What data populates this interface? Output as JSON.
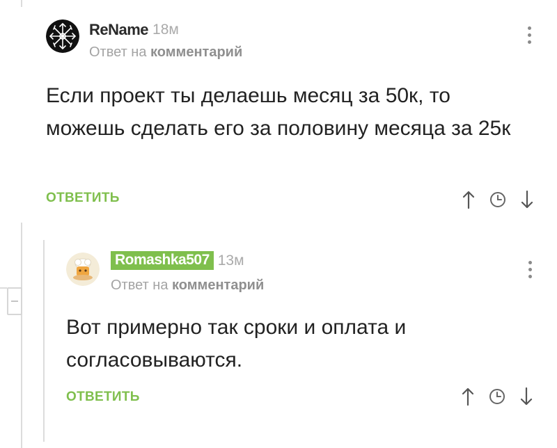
{
  "comments": [
    {
      "username": "ReName",
      "time": "18м",
      "reply_prefix": "Ответ на",
      "reply_target": "комментарий",
      "text": "Если проект ты делаешь месяц за 50к, то можешь сделать его за половину месяца за 25к",
      "reply_label": "ОТВЕТИТЬ"
    },
    {
      "username": "Romashka507",
      "time": "13м",
      "reply_prefix": "Ответ на",
      "reply_target": "комментарий",
      "text": "Вот примерно так сроки и оплата и согласовываются.",
      "reply_label": "ОТВЕТИТЬ"
    }
  ],
  "colors": {
    "accent_green": "#7fbf4d",
    "thread_line": "#dcdcdc",
    "muted_text": "#a3a3a3"
  },
  "icons": {
    "upvote": "arrow-up-icon",
    "save": "clock-icon",
    "downvote": "arrow-down-icon",
    "menu": "vertical-dots-icon",
    "collapse": "minus-icon"
  }
}
